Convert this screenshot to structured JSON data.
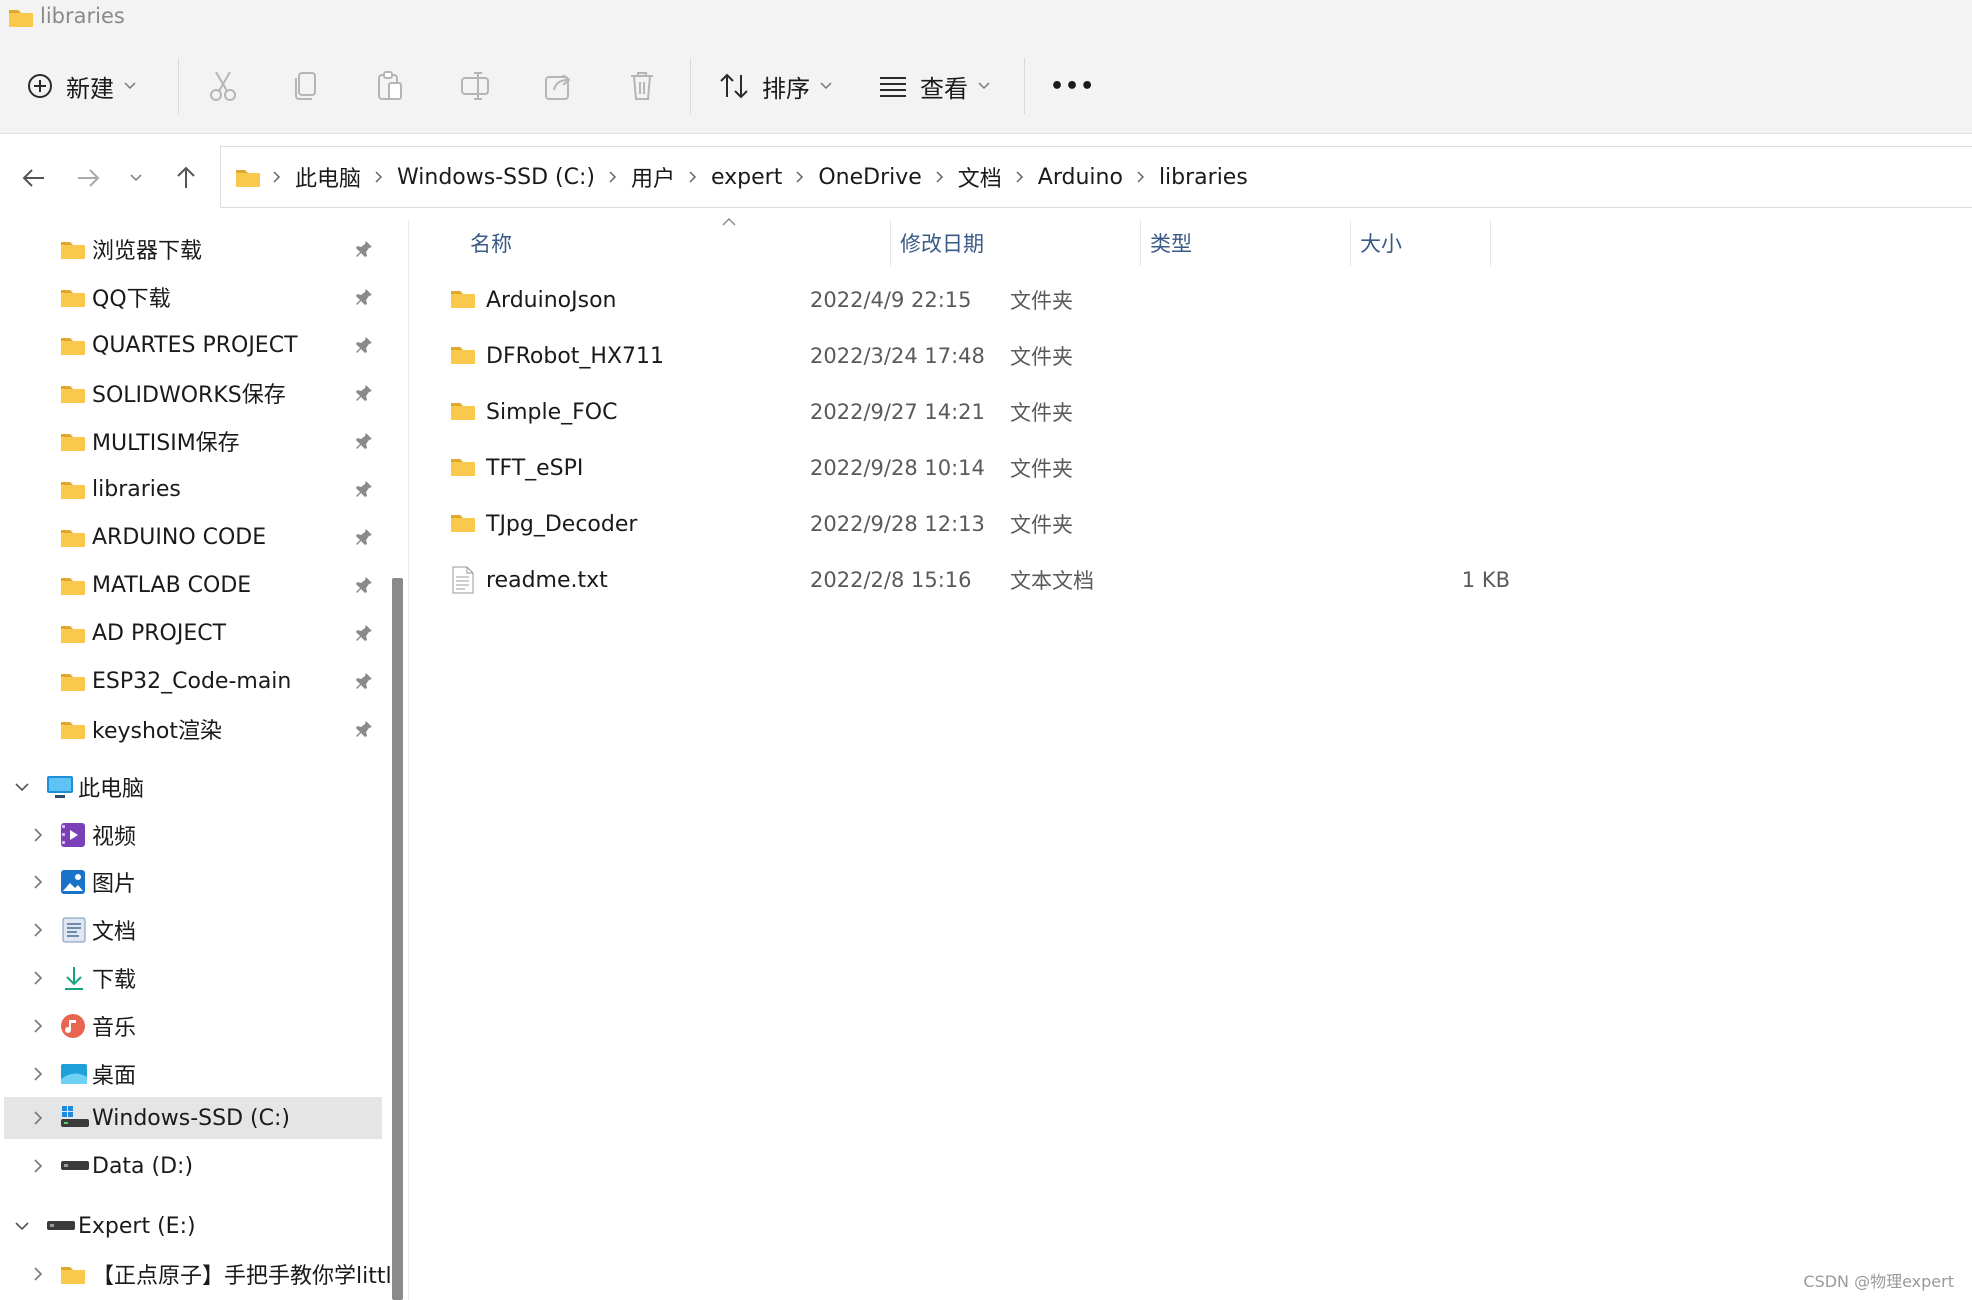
{
  "window": {
    "title": "libraries"
  },
  "toolbar": {
    "new_label": "新建",
    "sort_label": "排序",
    "view_label": "查看",
    "more_label": "•••"
  },
  "address": {
    "crumbs": [
      "此电脑",
      "Windows-SSD (C:)",
      "用户",
      "expert",
      "OneDrive",
      "文档",
      "Arduino",
      "libraries"
    ]
  },
  "sidebar": {
    "quick_access": [
      {
        "label": "浏览器下载"
      },
      {
        "label": "QQ下载"
      },
      {
        "label": "QUARTES PROJECT"
      },
      {
        "label": "SOLIDWORKS保存"
      },
      {
        "label": "MULTISIM保存"
      },
      {
        "label": "libraries"
      },
      {
        "label": "ARDUINO CODE"
      },
      {
        "label": "MATLAB CODE"
      },
      {
        "label": "AD PROJECT"
      },
      {
        "label": "ESP32_Code-main"
      },
      {
        "label": "keyshot渲染"
      }
    ],
    "this_pc": "此电脑",
    "pc_items": [
      {
        "label": "视频",
        "icon": "video-icon"
      },
      {
        "label": "图片",
        "icon": "pictures-icon"
      },
      {
        "label": "文档",
        "icon": "documents-icon"
      },
      {
        "label": "下载",
        "icon": "downloads-icon"
      },
      {
        "label": "音乐",
        "icon": "music-icon"
      },
      {
        "label": "桌面",
        "icon": "desktop-icon"
      },
      {
        "label": "Windows-SSD (C:)",
        "icon": "windows-drive-icon"
      },
      {
        "label": "Data (D:)",
        "icon": "drive-icon"
      }
    ],
    "expert_drive": "Expert (E:)",
    "expert_child": "【正点原子】手把手教你学littl"
  },
  "columns": {
    "name": "名称",
    "date": "修改日期",
    "type": "类型",
    "size": "大小"
  },
  "files": [
    {
      "name": "ArduinoJson",
      "date": "2022/4/9 22:15",
      "type": "文件夹",
      "size": ""
    },
    {
      "name": "DFRobot_HX711",
      "date": "2022/3/24 17:48",
      "type": "文件夹",
      "size": ""
    },
    {
      "name": "Simple_FOC",
      "date": "2022/9/27 14:21",
      "type": "文件夹",
      "size": ""
    },
    {
      "name": "TFT_eSPI",
      "date": "2022/9/28 10:14",
      "type": "文件夹",
      "size": ""
    },
    {
      "name": "TJpg_Decoder",
      "date": "2022/9/28 12:13",
      "type": "文件夹",
      "size": ""
    },
    {
      "name": "readme.txt",
      "date": "2022/2/8 15:16",
      "type": "文本文档",
      "size": "1 KB"
    }
  ],
  "watermark": "CSDN @物理expert",
  "colors": {
    "accent": "#2b6cb0",
    "folder": "#f8c94a",
    "selected_bg": "#e5e5e5"
  }
}
